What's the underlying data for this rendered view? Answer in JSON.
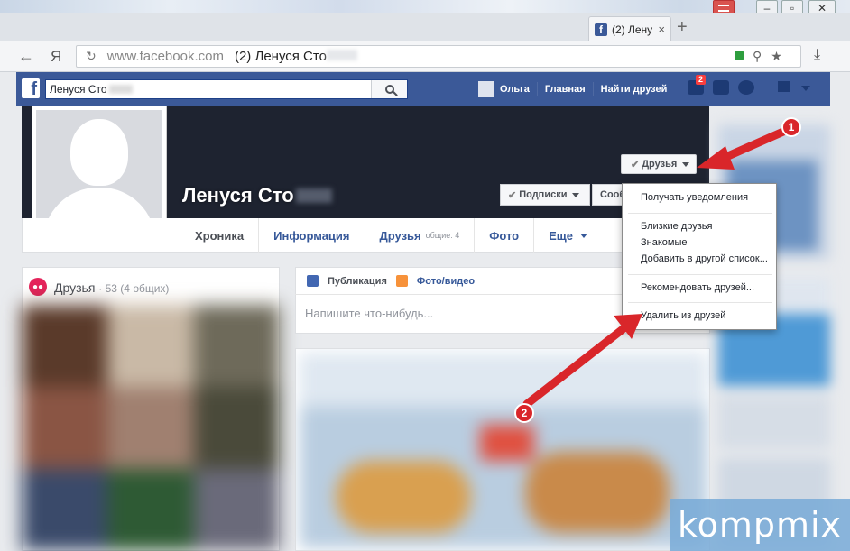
{
  "browser": {
    "tab_title": "(2) Лену",
    "tab_close": "×",
    "new_tab": "+",
    "yandex_button": "Я",
    "url_domain": "www.facebook.com",
    "url_title": "(2) Ленуся Сто",
    "icons": [
      "back-arrow-icon",
      "reload-icon",
      "lock-icon",
      "search-icon",
      "star-icon",
      "download-icon"
    ]
  },
  "fb_header": {
    "logo": "f",
    "search_value": "Ленуся Сто",
    "user_name": "Ольга",
    "home": "Главная",
    "find_friends": "Найти друзей",
    "friend_requests_badge": "2",
    "brand_color": "#3b5998"
  },
  "profile": {
    "name": "Ленуся Сто",
    "friends_button": "Друзья",
    "subscriptions_button": "Подписки",
    "message_button": "Сообщение",
    "tabs": {
      "timeline": "Хроника",
      "info": "Информация",
      "friends": "Друзья",
      "friends_common": "общие: 4",
      "photos": "Фото",
      "more": "Еще"
    }
  },
  "friends_box": {
    "title": "Друзья",
    "count": "· 53 (4 общих)"
  },
  "composer": {
    "post_tab": "Публикация",
    "photo_tab": "Фото/видео",
    "placeholder": "Напишите что-нибудь..."
  },
  "dropdown": {
    "items": [
      "Получать уведомления",
      "Близкие друзья",
      "Знакомые",
      "Добавить в другой список...",
      "Рекомендовать друзей...",
      "Удалить из друзей"
    ]
  },
  "annotations": {
    "marker_1": "1",
    "marker_2": "2",
    "arrow_color": "#d9262a"
  },
  "watermark": "kompmix"
}
